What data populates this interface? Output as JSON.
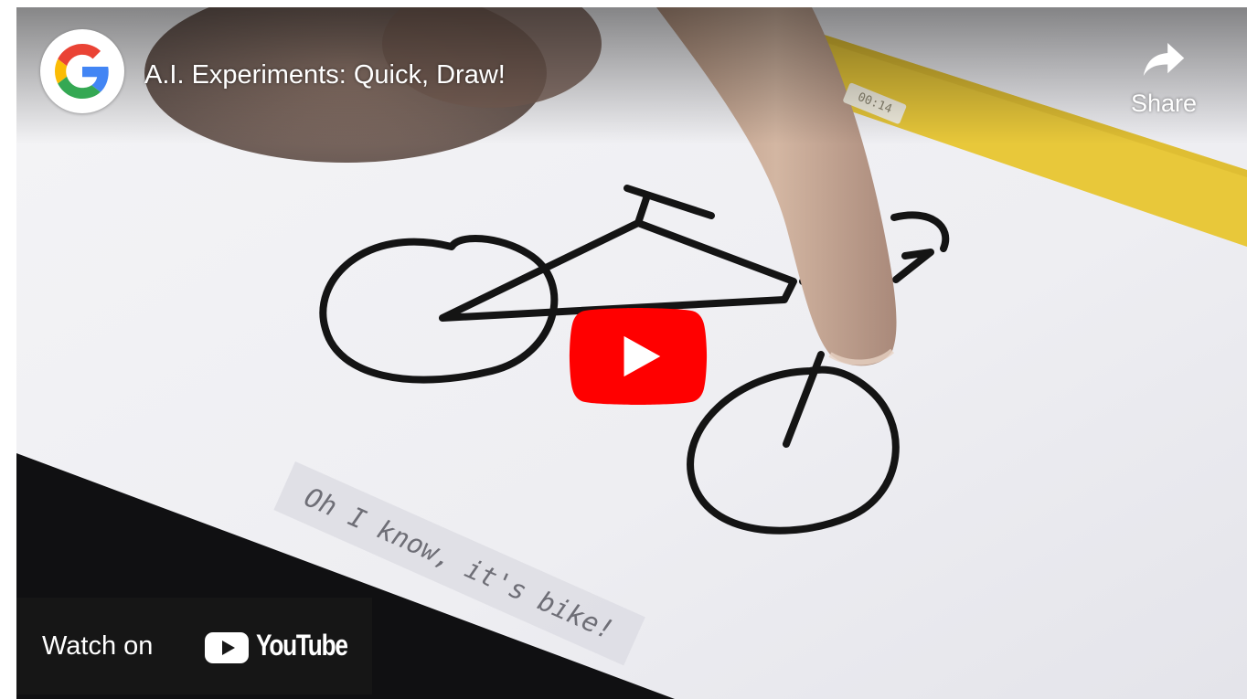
{
  "video": {
    "title": "A.I. Experiments: Quick, Draw!",
    "channel_icon": "google-g-logo"
  },
  "controls": {
    "share_label": "Share",
    "share_icon": "share-arrow-icon",
    "play_icon": "play-icon"
  },
  "watch_on": {
    "label": "Watch on",
    "brand": "YouTube",
    "brand_icon": "youtube-play-icon"
  },
  "frame": {
    "caption": "Oh I know, it's bike!",
    "screen_timer": "00:14"
  },
  "colors": {
    "play_red": "#FF0000",
    "overlay_dark": "#171717",
    "title_white": "#FFFFFF",
    "banner_yellow": "#E8C83A",
    "google_blue": "#4285F4",
    "google_red": "#EA4335",
    "google_yellow": "#FBBC05",
    "google_green": "#34A853"
  }
}
